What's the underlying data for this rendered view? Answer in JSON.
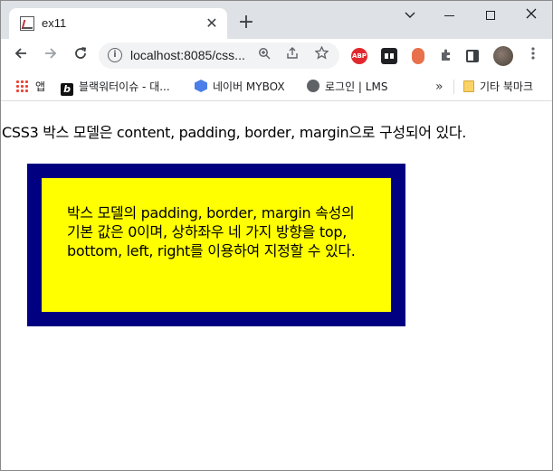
{
  "browser": {
    "tab_title": "ex11",
    "new_tab_glyph": "+",
    "close_glyph": "✕",
    "url": "localhost:8085/css...",
    "bookmarks": [
      {
        "label": "앱",
        "icon": "apps-grid-icon"
      },
      {
        "label": "블랙워터이슈 - 대...",
        "icon": "blackwater-icon"
      },
      {
        "label": "네이버 MYBOX",
        "icon": "naver-mybox-icon"
      },
      {
        "label": "로그인 | LMS",
        "icon": "globe-icon"
      }
    ],
    "bookmarks_overflow": "»",
    "other_bookmarks": "기타 북마크",
    "extensions": {
      "abp": "ABP"
    }
  },
  "page": {
    "intro": "CSS3 박스 모델은 content, padding, border, margin으로 구성되어 있다.",
    "box_text": "박스 모델의 padding, border, margin 속성의 기본 값은 0이며, 상하좌우 네 가지 방향을 top, bottom, left, right를 이용하여 지정할 수 있다."
  },
  "colors": {
    "border": "#000080",
    "box_background": "#ffff00"
  }
}
